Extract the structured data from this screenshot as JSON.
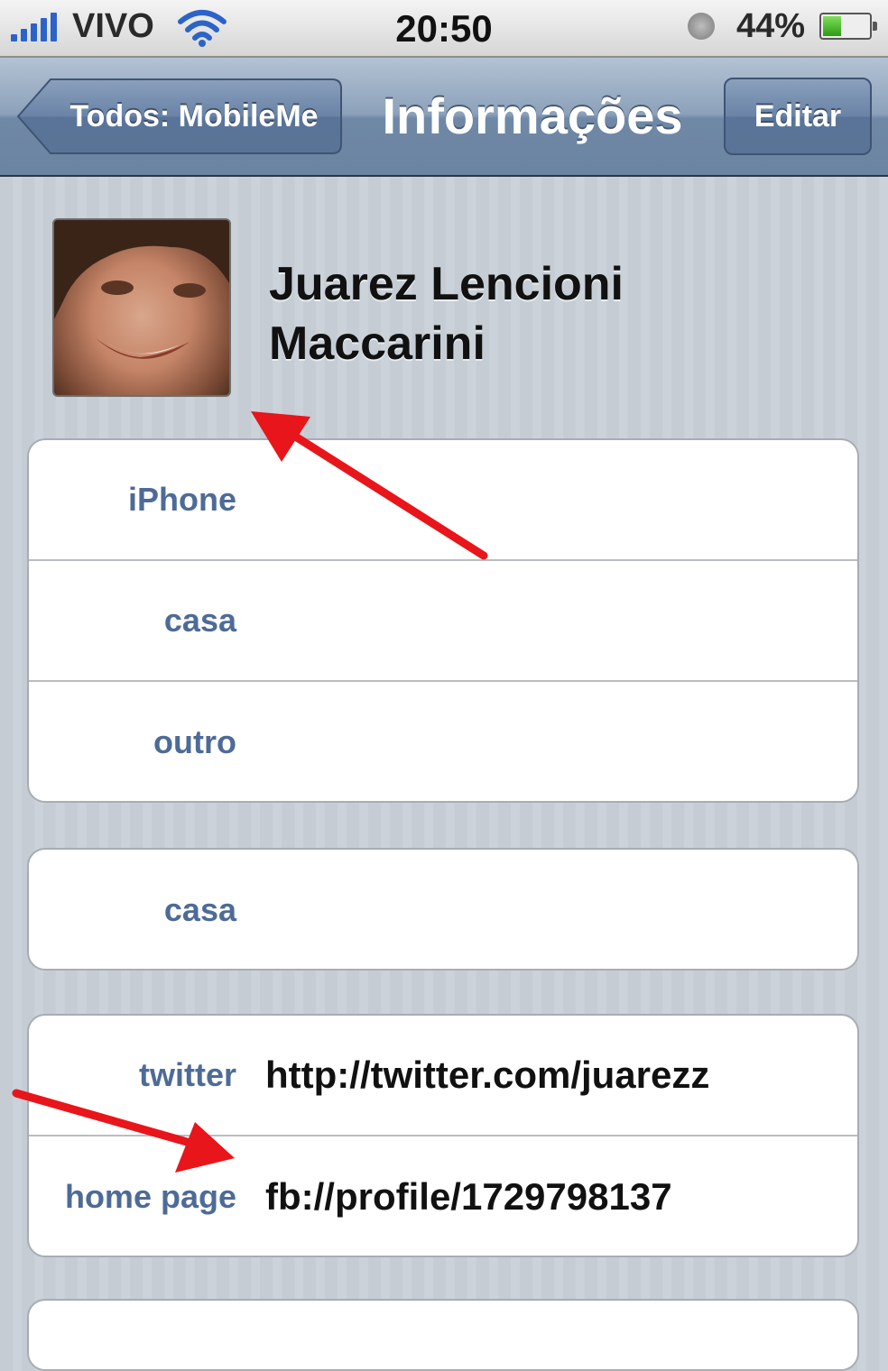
{
  "status_bar": {
    "carrier": "VIVO",
    "time": "20:50",
    "battery": "44%",
    "battery_level": 0.44
  },
  "nav": {
    "back_label": "Todos: MobileMe",
    "title": "Informações",
    "edit_label": "Editar"
  },
  "contact": {
    "name": "Juarez Lencioni Maccarini"
  },
  "phones": [
    {
      "label": "iPhone",
      "value": ""
    },
    {
      "label": "casa",
      "value": ""
    },
    {
      "label": "outro",
      "value": ""
    }
  ],
  "emails": [
    {
      "label": "casa",
      "value": ""
    }
  ],
  "urls": [
    {
      "label": "twitter",
      "value": "http://twitter.com/juarezz"
    },
    {
      "label": "home page",
      "value": "fb://profile/1729798137"
    }
  ],
  "colors": {
    "annotation_arrow": "#e8151b",
    "label_blue": "#4e6b97",
    "nav_blue": "#6f88a6"
  }
}
